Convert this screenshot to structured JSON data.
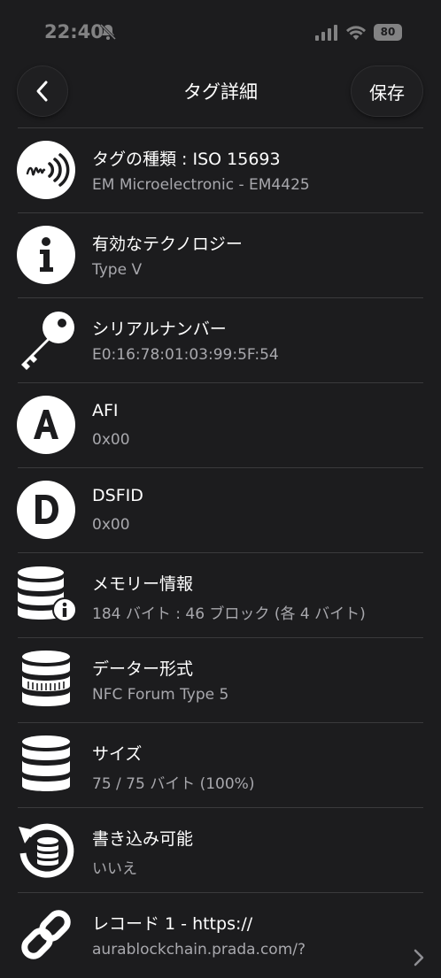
{
  "status_bar": {
    "time": "22:40",
    "battery": "80"
  },
  "nav": {
    "title": "タグ詳細",
    "save_label": "保存"
  },
  "rows": [
    {
      "title": "タグの種類 : ISO 15693",
      "value": "EM Microelectronic - EM4425",
      "icon": "nfc-signal-icon"
    },
    {
      "title": "有効なテクノロジー",
      "value": "Type V",
      "icon": "info-icon"
    },
    {
      "title": "シリアルナンバー",
      "value": "E0:16:78:01:03:99:5F:54",
      "icon": "key-icon"
    },
    {
      "title": "AFI",
      "value": "0x00",
      "icon": "letter-a-icon"
    },
    {
      "title": "DSFID",
      "value": "0x00",
      "icon": "letter-d-icon"
    },
    {
      "title": "メモリー情報",
      "value": "184 バイト : 46 ブロック (各 4 バイト)",
      "icon": "database-info-icon"
    },
    {
      "title": "データー形式",
      "value": "NFC Forum Type 5",
      "icon": "database-format-icon"
    },
    {
      "title": "サイズ",
      "value": "75 / 75 バイト (100%)",
      "icon": "database-icon"
    },
    {
      "title": "書き込み可能",
      "value": "いいえ",
      "icon": "writable-refresh-icon"
    },
    {
      "title": "レコード 1 - https://",
      "value": "aurablockchain.prada.com/?",
      "icon": "link-icon"
    }
  ]
}
